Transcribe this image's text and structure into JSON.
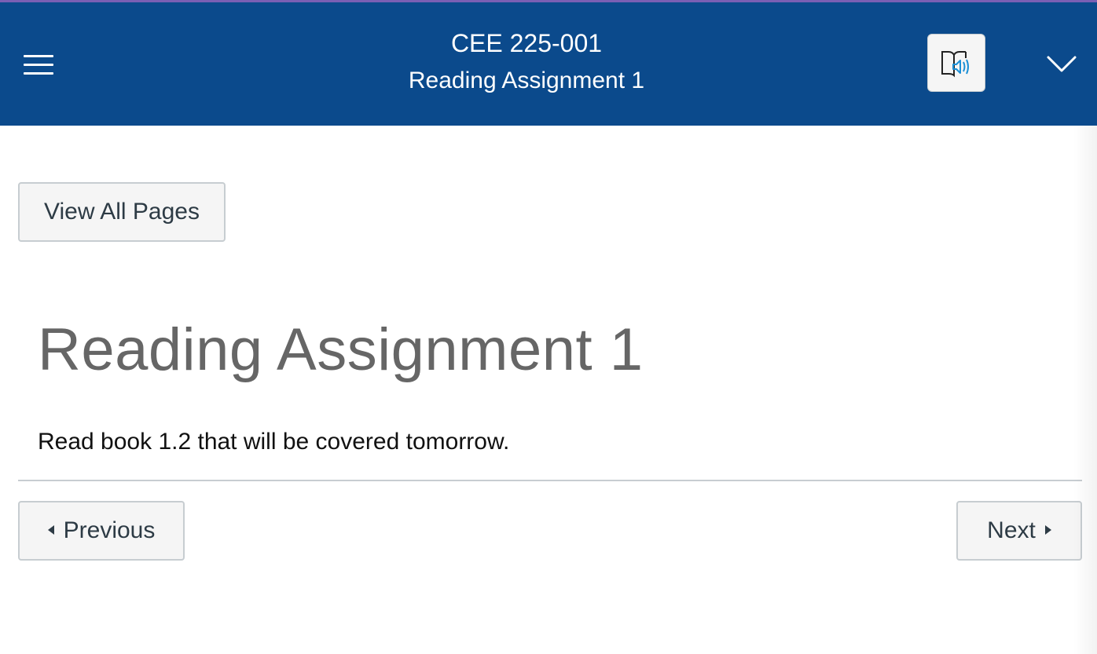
{
  "colors": {
    "header_bg": "#0b4a8c",
    "accent_line": "#7a5fb4",
    "button_bg": "#f5f5f5",
    "button_border": "#c7cdd1",
    "text_dark": "#2d3b45",
    "title_gray": "#666666",
    "speaker_blue": "#1a8fd6"
  },
  "header": {
    "menu_icon": "hamburger-menu-icon",
    "course_code": "CEE 225-001",
    "page_name": "Reading Assignment 1",
    "immersive_reader_icon": "immersive-reader-icon",
    "expand_icon": "chevron-down-icon"
  },
  "nav": {
    "view_all_label": "View All Pages"
  },
  "page": {
    "title": "Reading Assignment 1",
    "body": "Read book 1.2 that will be covered tomorrow."
  },
  "pager": {
    "previous_label": "Previous",
    "next_label": "Next",
    "previous_icon": "caret-left-icon",
    "next_icon": "caret-right-icon"
  }
}
